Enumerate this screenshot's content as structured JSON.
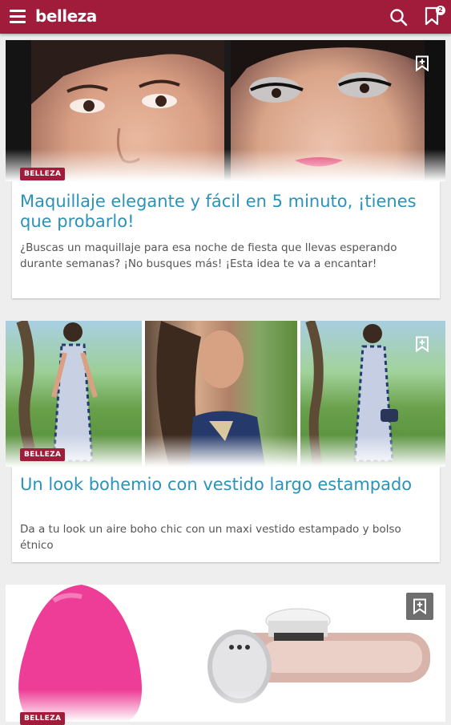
{
  "topbar": {
    "brand": "belleza",
    "bookmarks_count": "2",
    "menu_icon": "hamburger-menu-icon",
    "search_icon": "search-icon",
    "bookmarks_icon": "bookmark-icon"
  },
  "colors": {
    "brand": "#a11b3a",
    "title": "#2a93b9",
    "text": "#555555",
    "background": "#eeeeee"
  },
  "articles": [
    {
      "category": "BELLEZA",
      "title": "Maquillaje elegante y fácil en 5 minuto, ¡tienes que probarlo!",
      "description": "¿Buscas un maquillaje para esa noche de fiesta que llevas esperando durante semanas? ¡No busques más! ¡Esta idea te va a encantar!"
    },
    {
      "category": "BELLEZA",
      "title": "Un look bohemio con vestido largo estampado",
      "description": "Da a tu look un aire boho chic con un maxi vestido estampado y bolso étnico"
    },
    {
      "category": "BELLEZA"
    }
  ]
}
